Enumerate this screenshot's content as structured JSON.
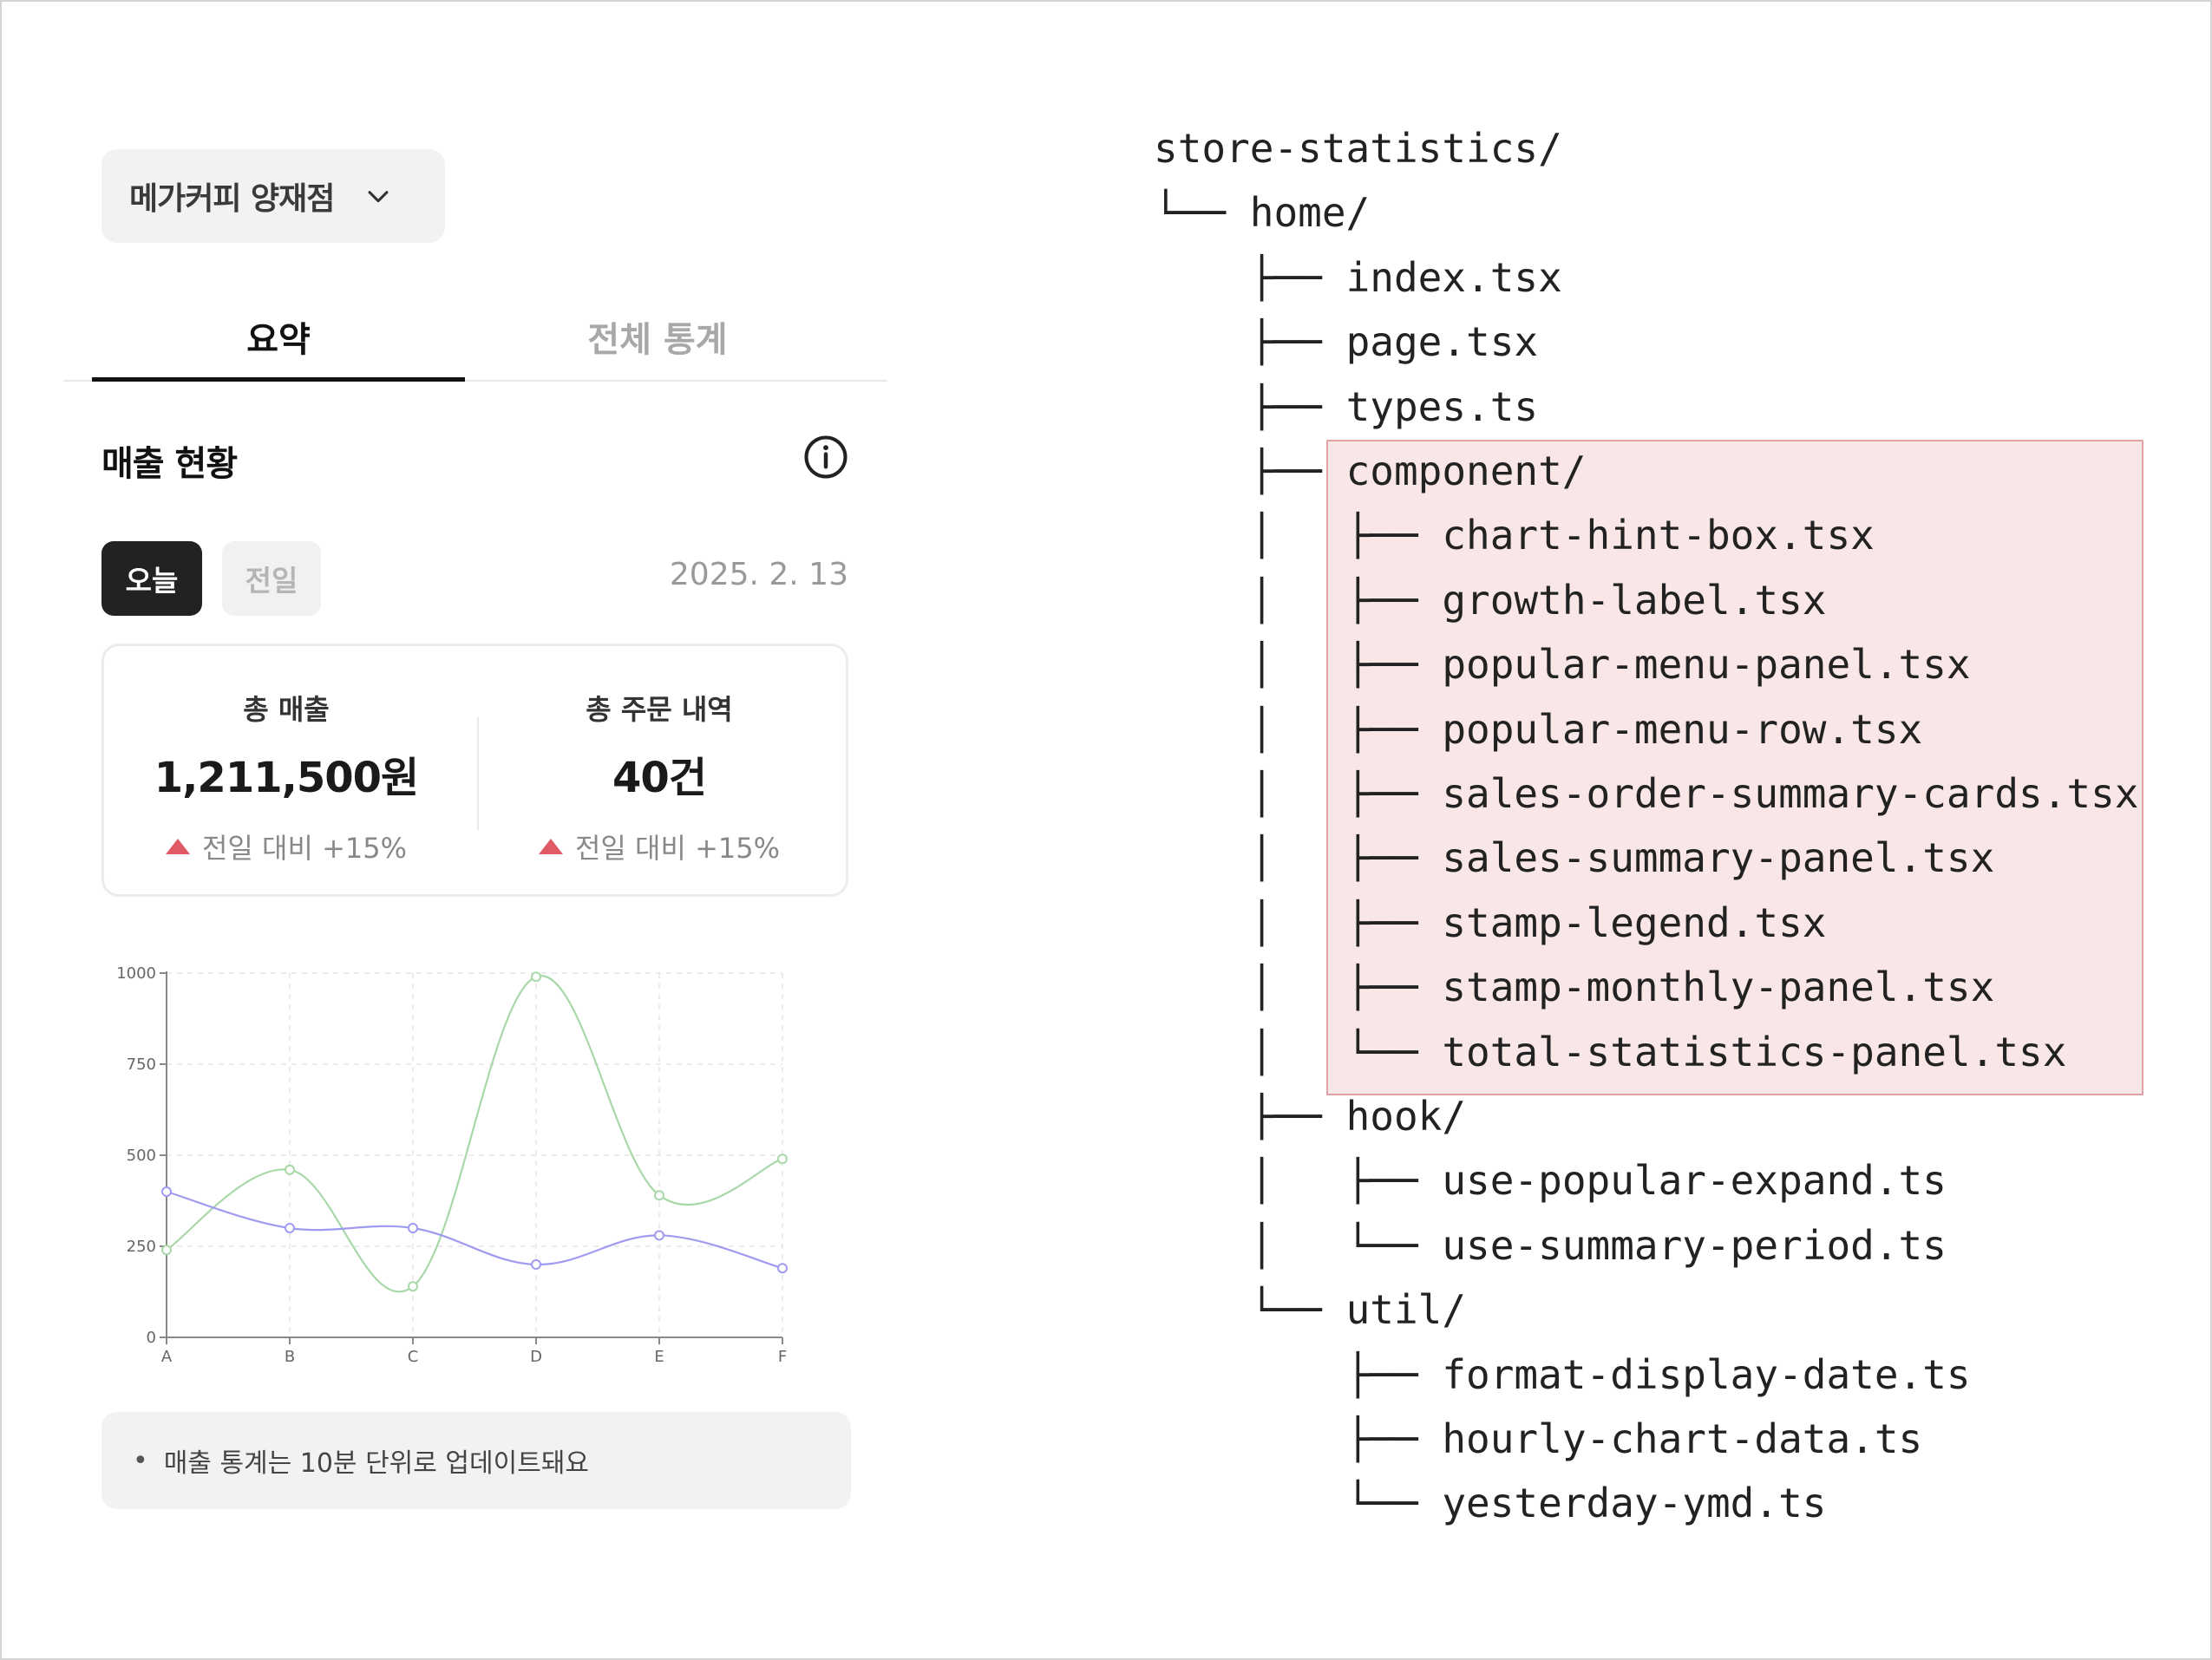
{
  "store_selector": {
    "name": "메가커피 양재점",
    "icon": "chevron-down-icon"
  },
  "tabs": [
    {
      "label": "요약",
      "active": true
    },
    {
      "label": "전체 통계",
      "active": false
    }
  ],
  "sales_section": {
    "title": "매출 현황",
    "info_icon": "info-icon"
  },
  "period": {
    "today_label": "오늘",
    "previous_label": "전일",
    "date": "2025. 2. 13"
  },
  "summary_cards": [
    {
      "label": "총 매출",
      "value": "1,211,500원",
      "growth": "전일 대비 +15%"
    },
    {
      "label": "총 주문 내역",
      "value": "40건",
      "growth": "전일 대비 +15%"
    }
  ],
  "colors": {
    "growth_up": "#e05a64",
    "series_green": "#a8d8a8",
    "series_purple": "#a09af0",
    "highlight_bg": "#f9e6e6"
  },
  "chart_data": {
    "type": "line",
    "categories": [
      "A",
      "B",
      "C",
      "D",
      "E",
      "F"
    ],
    "series": [
      {
        "color": "#a8d8a8",
        "values": [
          240,
          460,
          140,
          990,
          390,
          490
        ]
      },
      {
        "color": "#a09af0",
        "values": [
          400,
          300,
          300,
          200,
          280,
          190
        ]
      }
    ],
    "yticks": [
      "0",
      "250",
      "500",
      "750",
      "1000"
    ],
    "ylim": [
      0,
      1000
    ],
    "grid": true
  },
  "note": {
    "bullet": "•",
    "text": "매출 통계는 10분 단위로 업데이트돼요"
  },
  "file_tree": [
    {
      "prefix": "",
      "name": "store-statistics/"
    },
    {
      "prefix": "└── ",
      "name": "home/"
    },
    {
      "prefix": "    ├── ",
      "name": "index.tsx"
    },
    {
      "prefix": "    ├── ",
      "name": "page.tsx"
    },
    {
      "prefix": "    ├── ",
      "name": "types.ts"
    },
    {
      "prefix": "    ├── ",
      "name": "component/"
    },
    {
      "prefix": "    │   ├── ",
      "name": "chart-hint-box.tsx"
    },
    {
      "prefix": "    │   ├── ",
      "name": "growth-label.tsx"
    },
    {
      "prefix": "    │   ├── ",
      "name": "popular-menu-panel.tsx"
    },
    {
      "prefix": "    │   ├── ",
      "name": "popular-menu-row.tsx"
    },
    {
      "prefix": "    │   ├── ",
      "name": "sales-order-summary-cards.tsx"
    },
    {
      "prefix": "    │   ├── ",
      "name": "sales-summary-panel.tsx"
    },
    {
      "prefix": "    │   ├── ",
      "name": "stamp-legend.tsx"
    },
    {
      "prefix": "    │   ├── ",
      "name": "stamp-monthly-panel.tsx"
    },
    {
      "prefix": "    │   └── ",
      "name": "total-statistics-panel.tsx"
    },
    {
      "prefix": "    ├── ",
      "name": "hook/"
    },
    {
      "prefix": "    │   ├── ",
      "name": "use-popular-expand.ts"
    },
    {
      "prefix": "    │   └── ",
      "name": "use-summary-period.ts"
    },
    {
      "prefix": "    └── ",
      "name": "util/"
    },
    {
      "prefix": "        ├── ",
      "name": "format-display-date.ts"
    },
    {
      "prefix": "        ├── ",
      "name": "hourly-chart-data.ts"
    },
    {
      "prefix": "        └── ",
      "name": "yesterday-ymd.ts"
    }
  ]
}
